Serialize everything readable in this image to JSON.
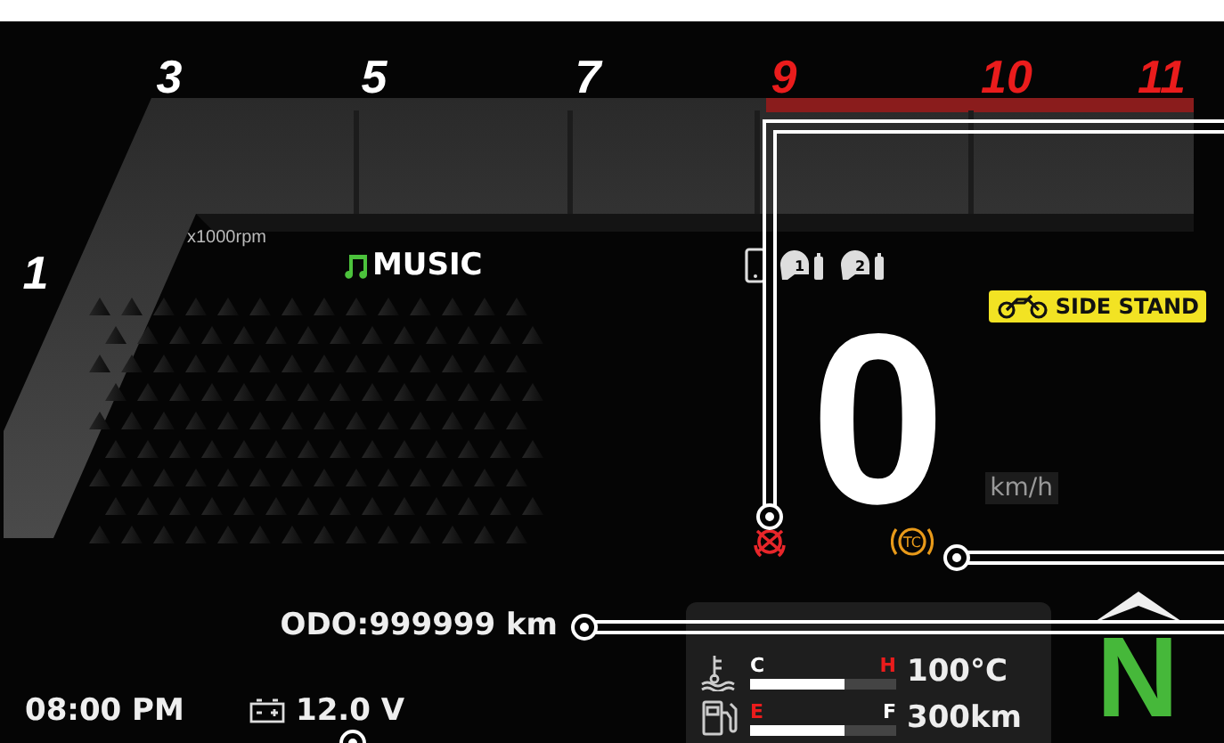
{
  "rpm_scale": [
    {
      "label": "1",
      "redline": false
    },
    {
      "label": "3",
      "redline": false
    },
    {
      "label": "5",
      "redline": false
    },
    {
      "label": "7",
      "redline": false
    },
    {
      "label": "9",
      "redline": true
    },
    {
      "label": "10",
      "redline": true
    },
    {
      "label": "11",
      "redline": true
    }
  ],
  "rpm_unit": "x1000rpm",
  "media": {
    "label": "MUSIC"
  },
  "helmets": [
    {
      "label": "1"
    },
    {
      "label": "2"
    }
  ],
  "side_stand": {
    "label": "SIDE STAND",
    "on": true
  },
  "speed": {
    "value": "0",
    "unit": "km/h"
  },
  "warnings": [
    {
      "kind": "abs",
      "color": "#e8262a"
    },
    {
      "kind": "tc",
      "color": "#e89a1a",
      "label": "TC"
    }
  ],
  "odometer": "ODO:999999 km",
  "clock": "08:00 PM",
  "voltage": "12.0 V",
  "temperature": {
    "low": "C",
    "high": "H",
    "level": 0.65,
    "reading": "100°C"
  },
  "fuel": {
    "low": "E",
    "high": "F",
    "level": 0.65,
    "reading": "300km"
  },
  "gear": {
    "label": "N"
  }
}
